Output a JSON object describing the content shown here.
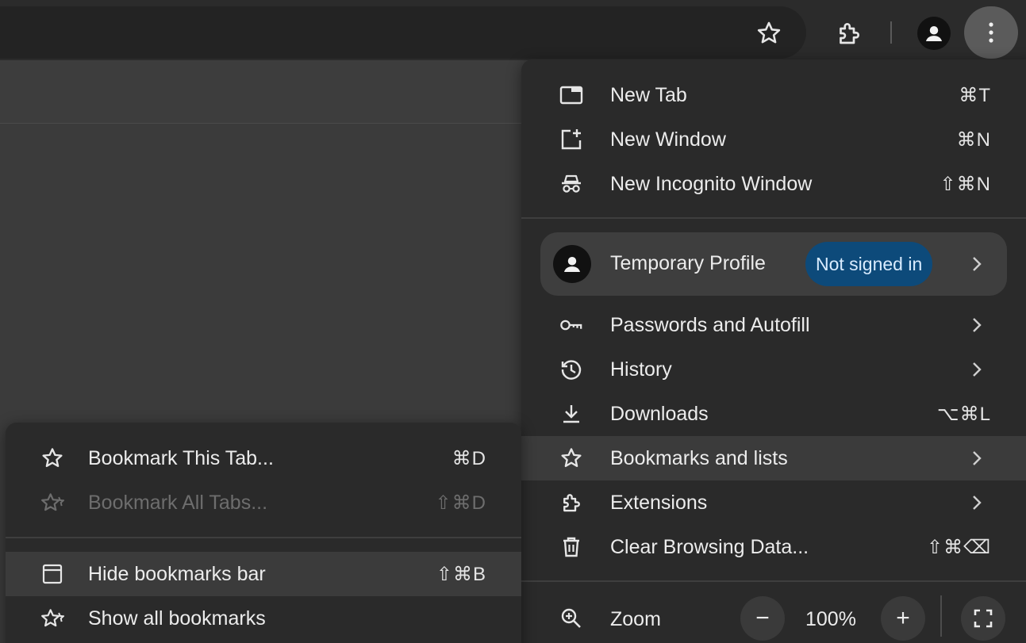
{
  "toolbar": {
    "star_icon": "star-outline-icon",
    "extensions_icon": "puzzle-icon",
    "profile_icon": "person-icon",
    "menu_icon": "vertical-dots-icon"
  },
  "main_menu": {
    "items_top": [
      {
        "label": "New Tab",
        "shortcut": "⌘T"
      },
      {
        "label": "New Window",
        "shortcut": "⌘N"
      },
      {
        "label": "New Incognito Window",
        "shortcut": "⇧⌘N"
      }
    ],
    "profile": {
      "name": "Temporary Profile",
      "badge": "Not signed in"
    },
    "items_mid": [
      {
        "label": "Passwords and Autofill"
      },
      {
        "label": "History"
      },
      {
        "label": "Downloads",
        "shortcut": "⌥⌘L"
      },
      {
        "label": "Bookmarks and lists"
      },
      {
        "label": "Extensions"
      },
      {
        "label": "Clear Browsing Data...",
        "shortcut": "⇧⌘⌫"
      }
    ],
    "zoom": {
      "label": "Zoom",
      "minus": "−",
      "value": "100%",
      "plus": "+"
    }
  },
  "bookmarks_submenu": {
    "items": [
      {
        "label": "Bookmark This Tab...",
        "shortcut": "⌘D"
      },
      {
        "label": "Bookmark All Tabs...",
        "shortcut": "⇧⌘D"
      },
      {
        "label": "Hide bookmarks bar",
        "shortcut": "⇧⌘B"
      },
      {
        "label": "Show all bookmarks"
      }
    ]
  },
  "colors": {
    "menu_bg": "#2a2a2a",
    "hover_bg": "#3b3b3b",
    "badge_bg": "#0d4a7a",
    "badge_text": "#d9ecff"
  }
}
